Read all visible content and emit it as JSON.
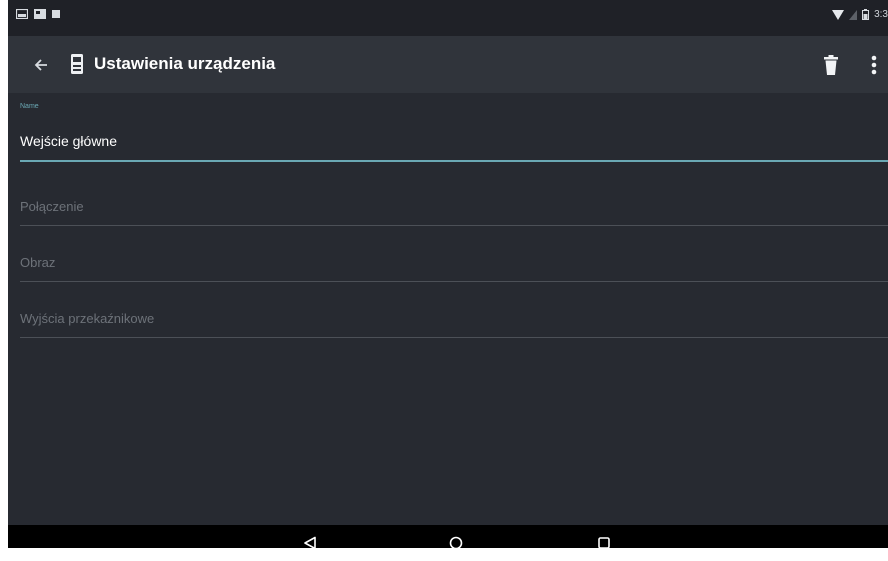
{
  "status_bar": {
    "left_icons": [
      "notification-icon",
      "gallery-icon",
      "stop-icon"
    ],
    "right_icons": [
      "wifi-icon",
      "signal-icon",
      "battery-icon"
    ],
    "time": "3:3"
  },
  "app_bar": {
    "back_icon": "arrow-left-icon",
    "device_icon": "intercom-device-icon",
    "title": "Ustawienia urządzenia",
    "delete_icon": "trash-icon",
    "more_icon": "more-vertical-icon"
  },
  "form": {
    "name_label": "Name",
    "name_value": "Wejście główne",
    "fields": [
      {
        "label": "Połączenie"
      },
      {
        "label": "Obraz"
      },
      {
        "label": "Wyjścia przekaźnikowe"
      }
    ]
  },
  "nav_bar": {
    "back_icon": "triangle-back-icon",
    "home_icon": "circle-home-icon",
    "recents_icon": "square-recents-icon"
  },
  "colors": {
    "accent": "#6aa8b4",
    "background": "#272a31",
    "app_bar": "#30343b",
    "status_bar": "#1f2127",
    "hint_text": "#6d7279",
    "divider": "#4c5057"
  }
}
